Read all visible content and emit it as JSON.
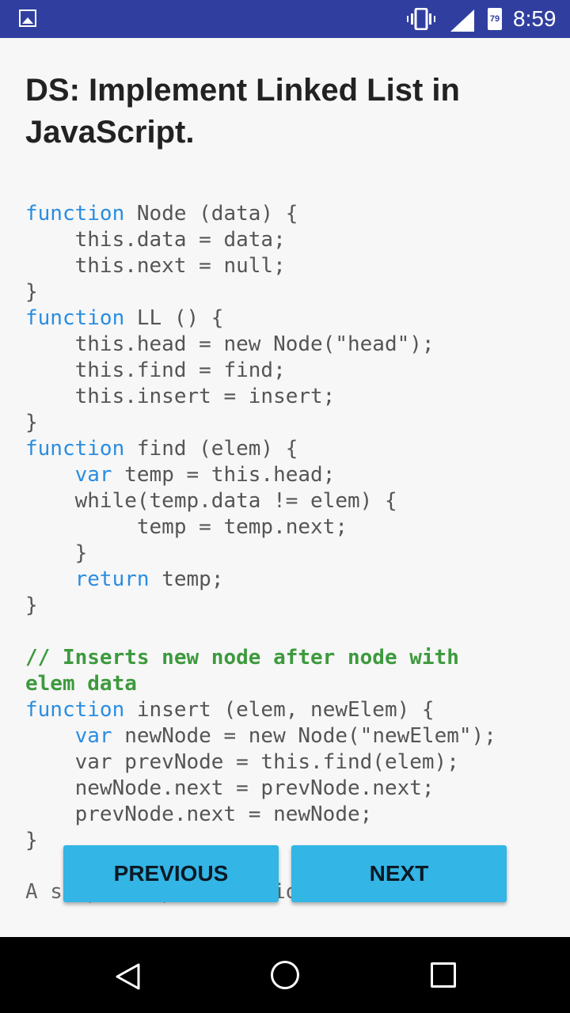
{
  "status_bar": {
    "time": "8:59",
    "battery_level": "79",
    "icons": [
      "image-icon",
      "vibrate-icon",
      "signal-icon",
      "battery-icon"
    ]
  },
  "article": {
    "title": "DS: Implement Linked List in JavaScript.",
    "code_lines": [
      [
        {
          "t": "function",
          "c": "kw"
        },
        {
          "t": " Node (data) {"
        }
      ],
      [
        {
          "t": "    this.data = data;"
        }
      ],
      [
        {
          "t": "    this.next = null;"
        }
      ],
      [
        {
          "t": "}"
        }
      ],
      [
        {
          "t": "function",
          "c": "kw"
        },
        {
          "t": " LL () {"
        }
      ],
      [
        {
          "t": "    this.head = new Node(\"head\");"
        }
      ],
      [
        {
          "t": "    this.find = find;"
        }
      ],
      [
        {
          "t": "    this.insert = insert;"
        }
      ],
      [
        {
          "t": "}"
        }
      ],
      [
        {
          "t": "function",
          "c": "kw"
        },
        {
          "t": " find (elem) {"
        }
      ],
      [
        {
          "t": "    "
        },
        {
          "t": "var",
          "c": "kw"
        },
        {
          "t": " temp = this.head;"
        }
      ],
      [
        {
          "t": "    while(temp.data != elem) {"
        }
      ],
      [
        {
          "t": "         temp = temp.next;"
        }
      ],
      [
        {
          "t": "    }"
        }
      ],
      [
        {
          "t": "    "
        },
        {
          "t": "return",
          "c": "kw"
        },
        {
          "t": " temp;"
        }
      ],
      [
        {
          "t": "}"
        }
      ],
      [
        {
          "t": ""
        }
      ],
      [
        {
          "t": "// Inserts new node after node with",
          "c": "cm"
        }
      ],
      [
        {
          "t": "elem data",
          "c": "cm"
        }
      ],
      [
        {
          "t": "function",
          "c": "kw"
        },
        {
          "t": " insert (elem, newElem) {"
        }
      ],
      [
        {
          "t": "    "
        },
        {
          "t": "var",
          "c": "kw"
        },
        {
          "t": " newNode = new Node(\"newElem\");"
        }
      ],
      [
        {
          "t": "    var prevNode = this.find(elem);"
        }
      ],
      [
        {
          "t": "    newNode.next = prevNode.next;"
        }
      ],
      [
        {
          "t": "    prevNode.next = newNode;"
        }
      ],
      [
        {
          "t": "}"
        }
      ]
    ],
    "trailing_text": "A simple implementation"
  },
  "buttons": {
    "previous": "PREVIOUS",
    "next": "NEXT"
  },
  "nav": {
    "back": "back-icon",
    "home": "home-icon",
    "recents": "recents-icon"
  }
}
